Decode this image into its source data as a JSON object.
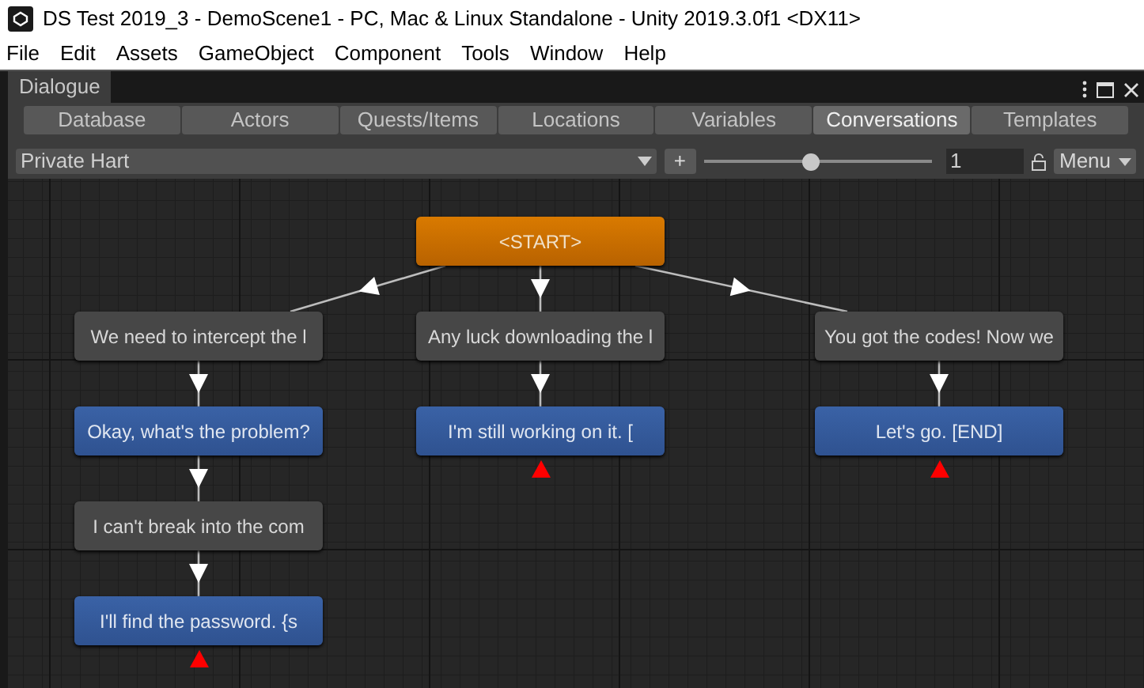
{
  "window": {
    "title": "DS Test 2019_3 - DemoScene1 - PC, Mac & Linux Standalone - Unity 2019.3.0f1 <DX11>"
  },
  "menu": [
    "File",
    "Edit",
    "Assets",
    "GameObject",
    "Component",
    "Tools",
    "Window",
    "Help"
  ],
  "panel": {
    "title": "Dialogue"
  },
  "tabs": [
    {
      "label": "Database",
      "selected": false
    },
    {
      "label": "Actors",
      "selected": false
    },
    {
      "label": "Quests/Items",
      "selected": false
    },
    {
      "label": "Locations",
      "selected": false
    },
    {
      "label": "Variables",
      "selected": false
    },
    {
      "label": "Conversations",
      "selected": true
    },
    {
      "label": "Templates",
      "selected": false
    }
  ],
  "toolbar": {
    "conversation": "Private Hart",
    "add": "+",
    "zoom": {
      "level": 0.47
    },
    "value": "1",
    "menu": "Menu"
  },
  "graph": {
    "kind": "start",
    "text": "<START>",
    "children": [
      {
        "kind": "npc",
        "text": "We need to intercept the l",
        "children": [
          {
            "kind": "player",
            "text": "Okay, what's the problem?",
            "children": [
              {
                "kind": "npc",
                "text": "I can't break into the com",
                "children": [
                  {
                    "kind": "player",
                    "text": "I'll find the password. {s",
                    "end": true
                  }
                ]
              }
            ]
          }
        ]
      },
      {
        "kind": "npc",
        "text": "Any luck downloading the l",
        "children": [
          {
            "kind": "player",
            "text": "I'm still working on it. [",
            "end": true
          }
        ]
      },
      {
        "kind": "npc",
        "text": "You got the codes! Now we",
        "children": [
          {
            "kind": "player",
            "text": "Let's go. [END]",
            "end": true
          }
        ]
      }
    ]
  }
}
